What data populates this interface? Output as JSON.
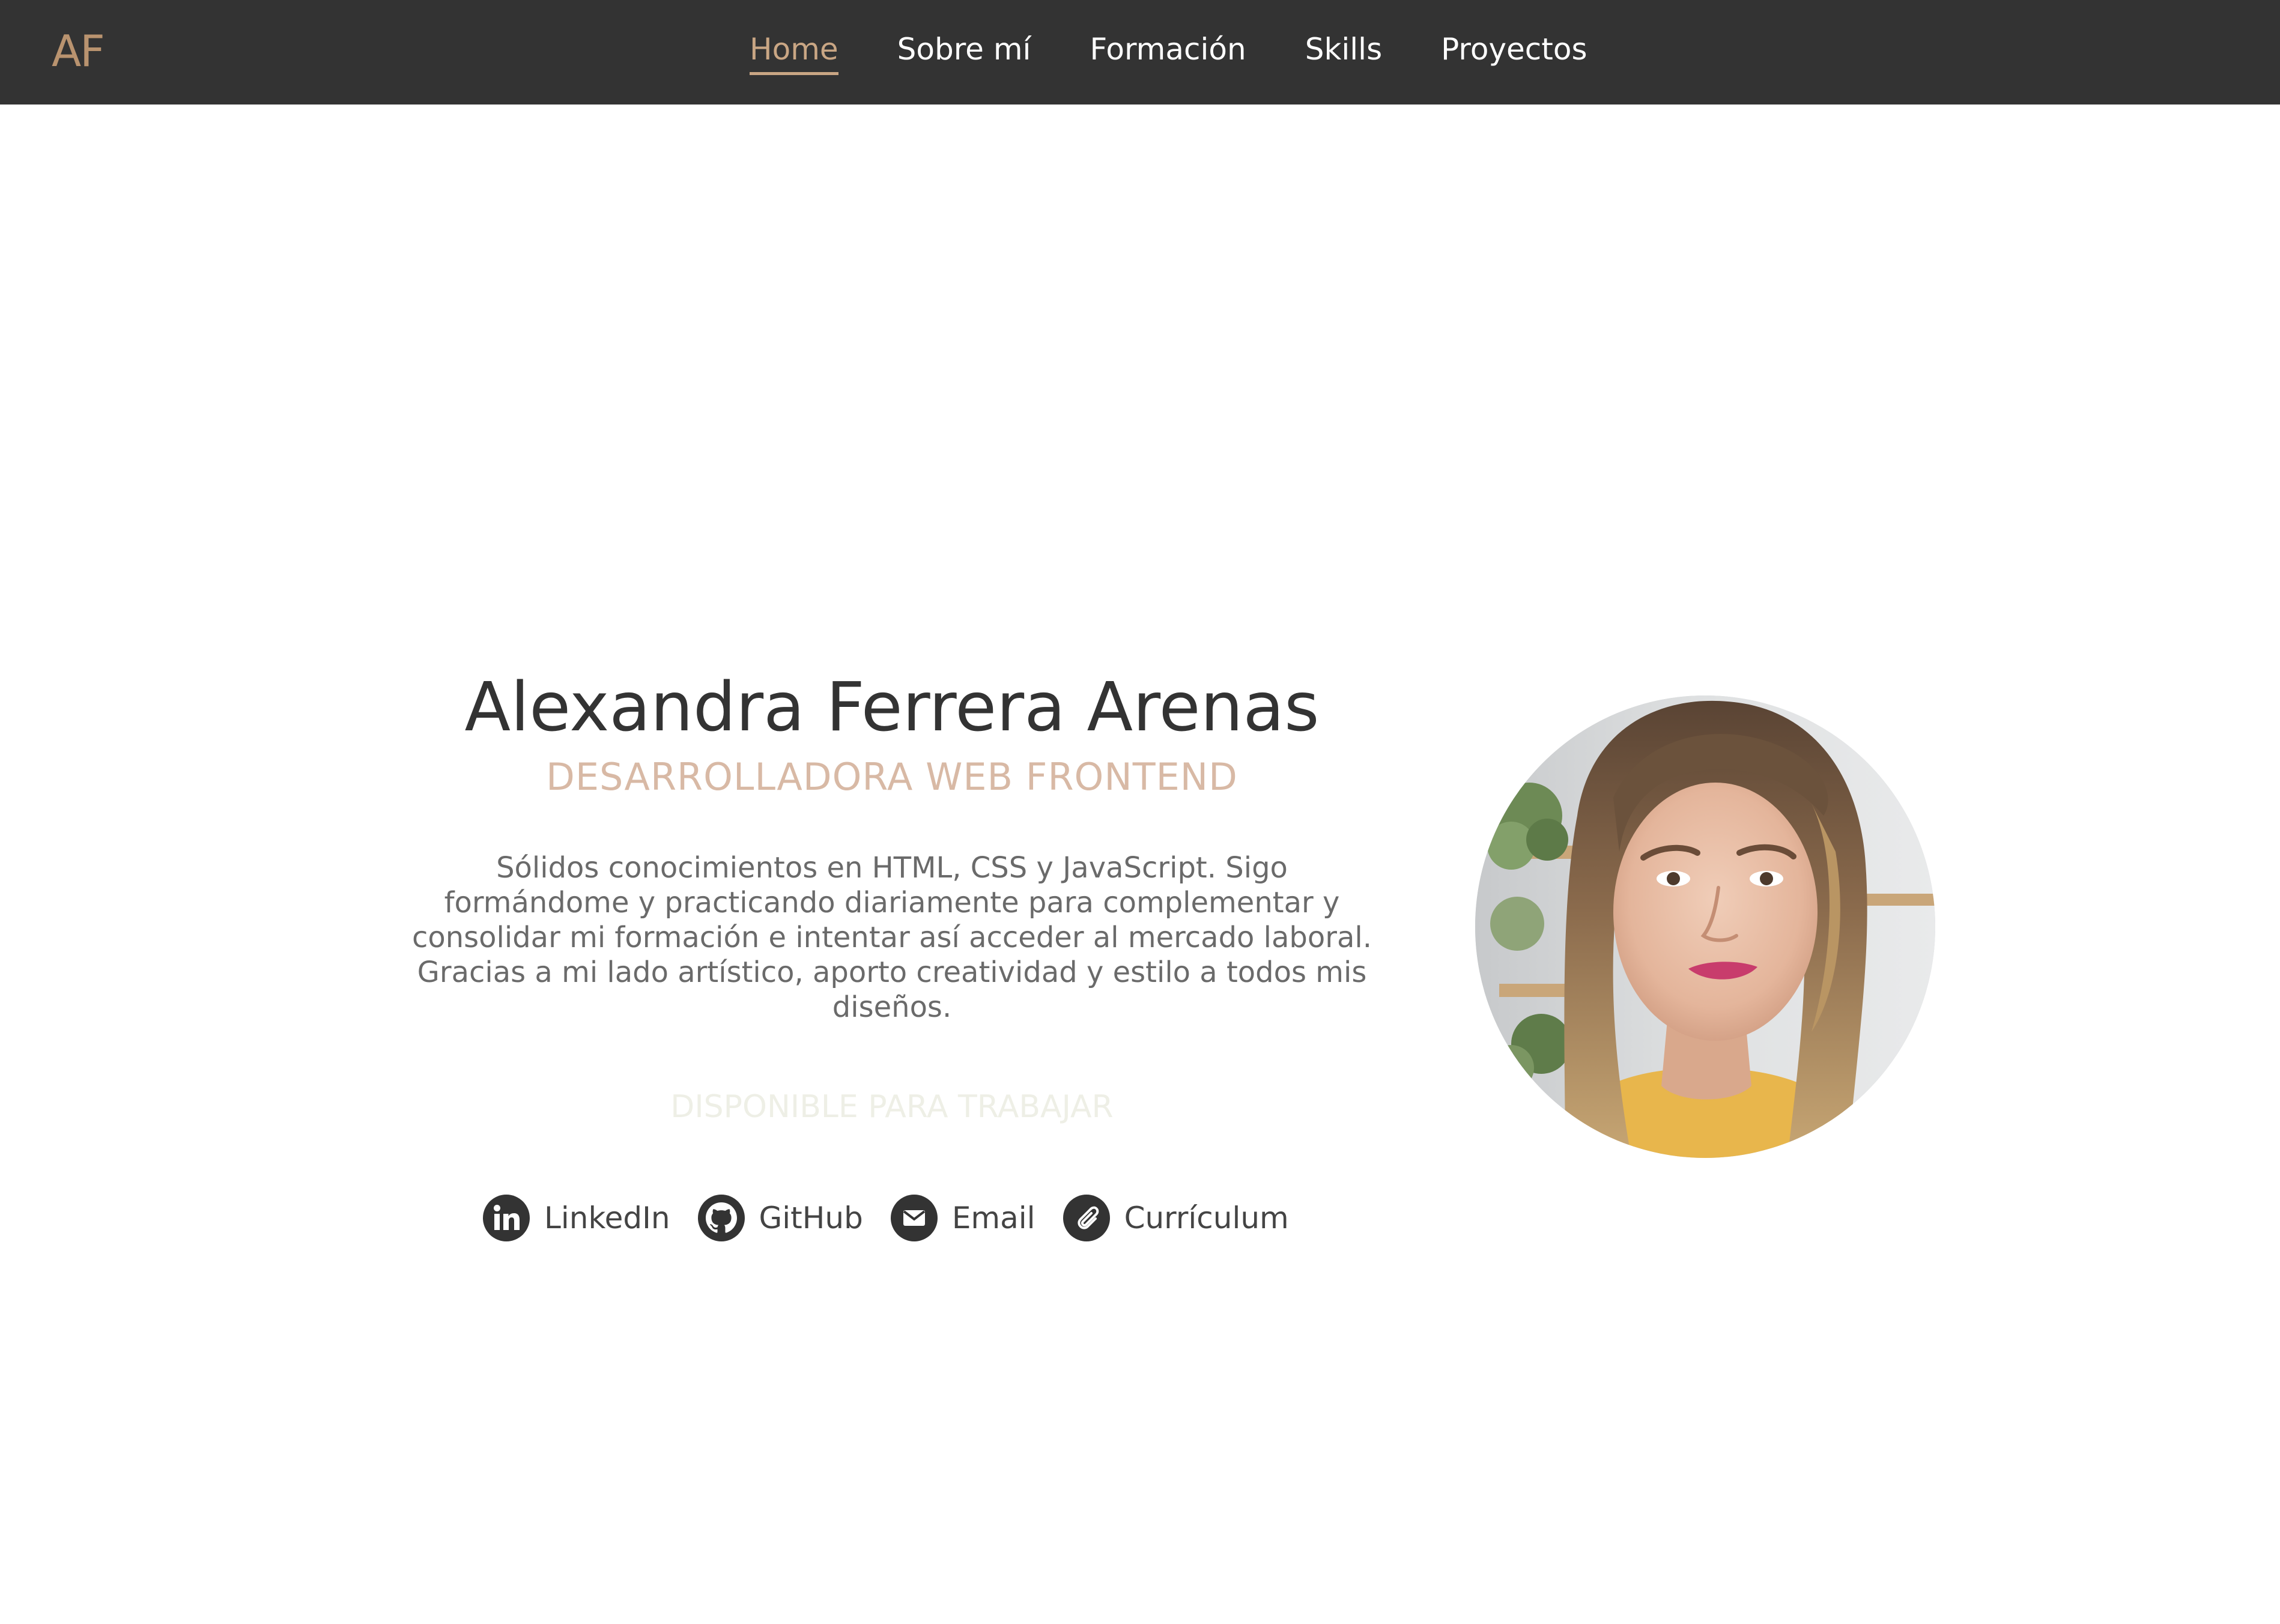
{
  "logo": {
    "text": "AF",
    "color": "#b9936f"
  },
  "nav": {
    "items": [
      {
        "label": "Home",
        "active": true
      },
      {
        "label": "Sobre mí",
        "active": false
      },
      {
        "label": "Formación",
        "active": false
      },
      {
        "label": "Skills",
        "active": false
      },
      {
        "label": "Proyectos",
        "active": false
      }
    ],
    "background": "#333333",
    "active_color": "#c9a684"
  },
  "hero": {
    "name": "Alexandra Ferrera Arenas",
    "role": "DESARROLLADORA WEB FRONTEND",
    "description": "Sólidos conocimientos en HTML, CSS y JavaScript. Sigo formándome y practicando diariamente para complementar y consolidar mi formación e intentar así acceder al mercado laboral. Gracias a mi lado artístico, aporto creatividad y estilo a todos mis diseños.",
    "availability": "DISPONIBLE PARA TRABAJAR"
  },
  "social": {
    "links": [
      {
        "label": "LinkedIn",
        "icon": "linkedin-icon"
      },
      {
        "label": "GitHub",
        "icon": "github-icon"
      },
      {
        "label": "Email",
        "icon": "email-icon"
      },
      {
        "label": "Currículum",
        "icon": "paperclip-icon"
      }
    ]
  },
  "profile": {
    "image": "profile-photo"
  }
}
